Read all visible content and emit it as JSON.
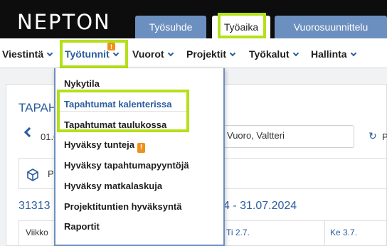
{
  "app": {
    "logo": "NEPTON"
  },
  "top_tabs": [
    {
      "label": "Työsuhde",
      "active": false
    },
    {
      "label": "Työaika",
      "active": true
    },
    {
      "label": "Vuorosuunnittelu",
      "active": false
    }
  ],
  "main_menu": [
    {
      "label": "Viestintä"
    },
    {
      "label": "Työtunnit",
      "active": true,
      "badge": "!"
    },
    {
      "label": "Vuorot"
    },
    {
      "label": "Projektit"
    },
    {
      "label": "Työkalut"
    },
    {
      "label": "Hallinta"
    }
  ],
  "dropdown": {
    "items": [
      {
        "label": "Nykytila"
      },
      {
        "label": "Tapahtumat kalenterissa",
        "active": true
      },
      {
        "label": "Tapahtumat taulukossa"
      },
      {
        "label": "Hyväksy tunteja",
        "badge": "!"
      },
      {
        "label": "Hyväksy tapahtumapyyntöjä"
      },
      {
        "label": "Hyväksy matkalaskuja"
      },
      {
        "label": "Projektituntien hyväksyntä"
      },
      {
        "label": "Raportit"
      }
    ]
  },
  "background_page": {
    "title_partial": "TAPAH",
    "date_start_partial": "01.0",
    "person_value": "Vuoro, Valtteri",
    "refresh_label_partial": "P",
    "tool_label_partial": "P",
    "period_left_partial": "31313",
    "period_right_partial": "4 - 31.07.2024",
    "table_headers": {
      "week": "Viikko",
      "tue": "Ti 2.7.",
      "wed": "Ke 3.7."
    }
  },
  "colors": {
    "highlight": "#b4e01a",
    "accent": "#2b5c9e",
    "tab_inactive": "#6b8fbf",
    "badge": "#f0901a",
    "topbar": "#0d0d0d"
  }
}
